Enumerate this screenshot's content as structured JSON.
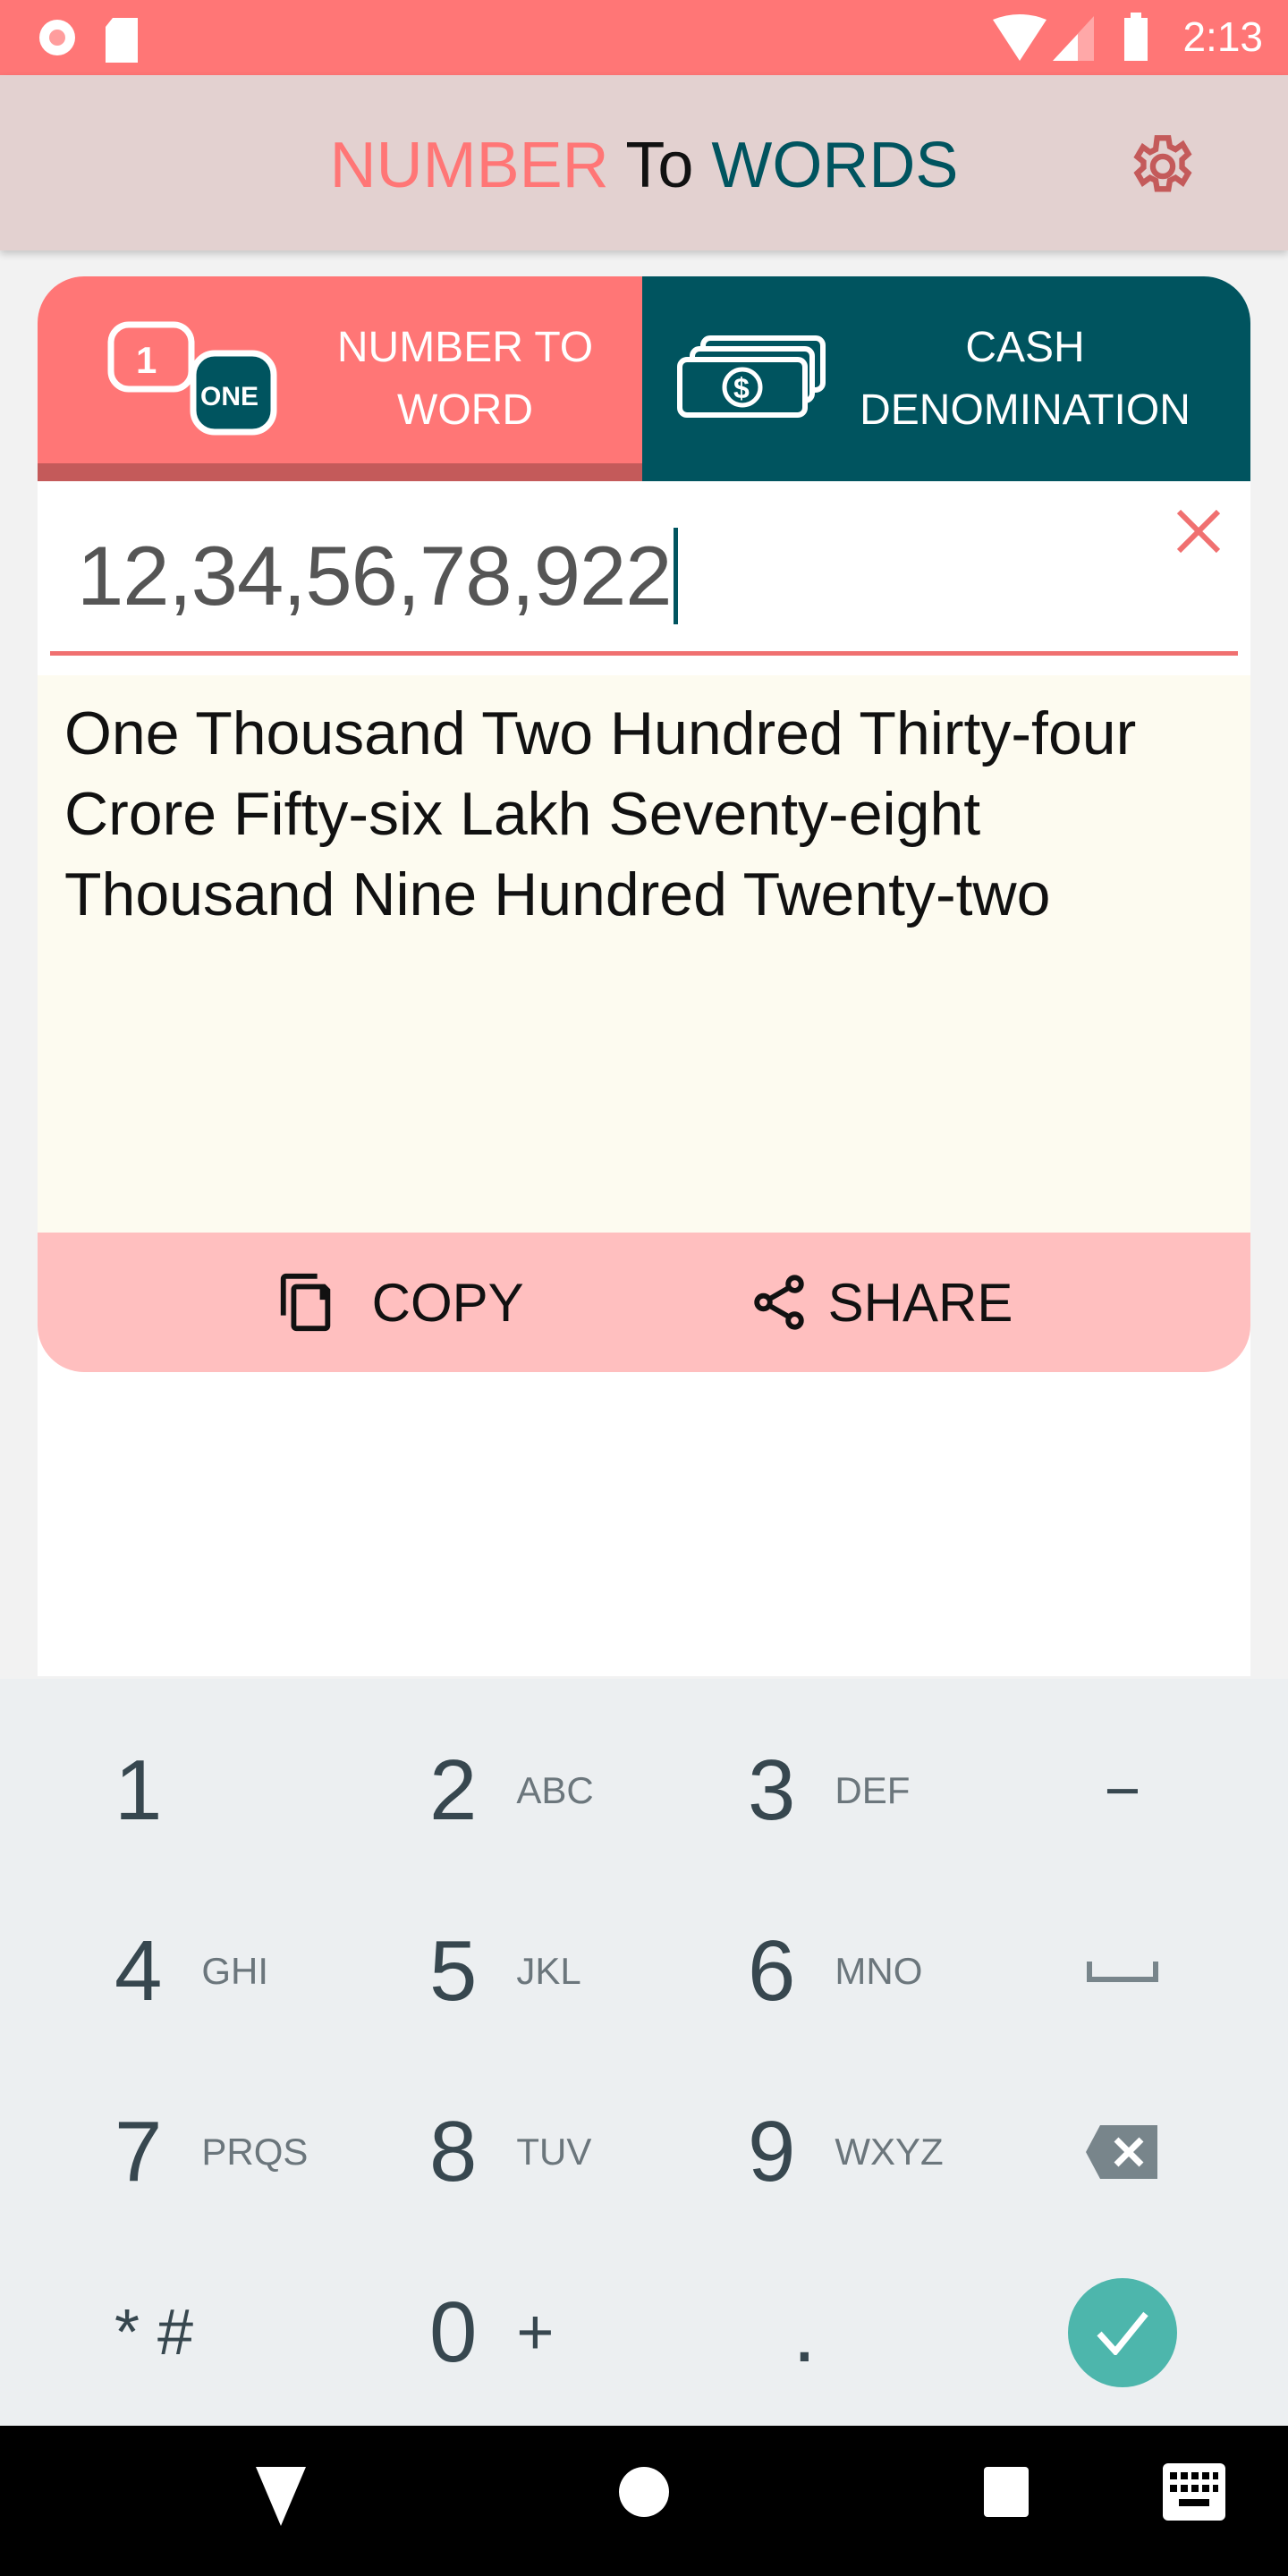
{
  "status": {
    "time": "2:13"
  },
  "header": {
    "title_part1": "NUMBER",
    "title_part2": "To",
    "title_part3": "WORDS",
    "colors": {
      "part1": "#ff7676",
      "part3": "#00545f"
    }
  },
  "tabs": [
    {
      "label_line1": "NUMBER TO",
      "label_line2": "WORD",
      "icon_badge_top": "1",
      "icon_badge_bottom": "ONE",
      "active": true
    },
    {
      "label_line1": "CASH",
      "label_line2": "DENOMINATION",
      "active": false
    }
  ],
  "input": {
    "value": "12,34,56,78,922"
  },
  "result": {
    "text": "One Thousand Two Hundred Thirty-four Crore Fifty-six Lakh Seventy-eight Thousand Nine Hundred Twenty-two"
  },
  "actions": {
    "copy": "COPY",
    "share": "SHARE"
  },
  "keyboard": {
    "keys": [
      {
        "d": "1",
        "l": ""
      },
      {
        "d": "2",
        "l": "ABC"
      },
      {
        "d": "3",
        "l": "DEF"
      },
      {
        "d": "−",
        "l": ""
      },
      {
        "d": "4",
        "l": "GHI"
      },
      {
        "d": "5",
        "l": "JKL"
      },
      {
        "d": "6",
        "l": "MNO"
      },
      {
        "d": "␣",
        "l": ""
      },
      {
        "d": "7",
        "l": "PRQS"
      },
      {
        "d": "8",
        "l": "TUV"
      },
      {
        "d": "9",
        "l": "WXYZ"
      },
      {
        "d": "⌫",
        "l": ""
      },
      {
        "d": "* #",
        "l": ""
      },
      {
        "d": "0",
        "l": "+"
      },
      {
        "d": ".",
        "l": ""
      },
      {
        "d": "✓",
        "l": ""
      }
    ]
  }
}
